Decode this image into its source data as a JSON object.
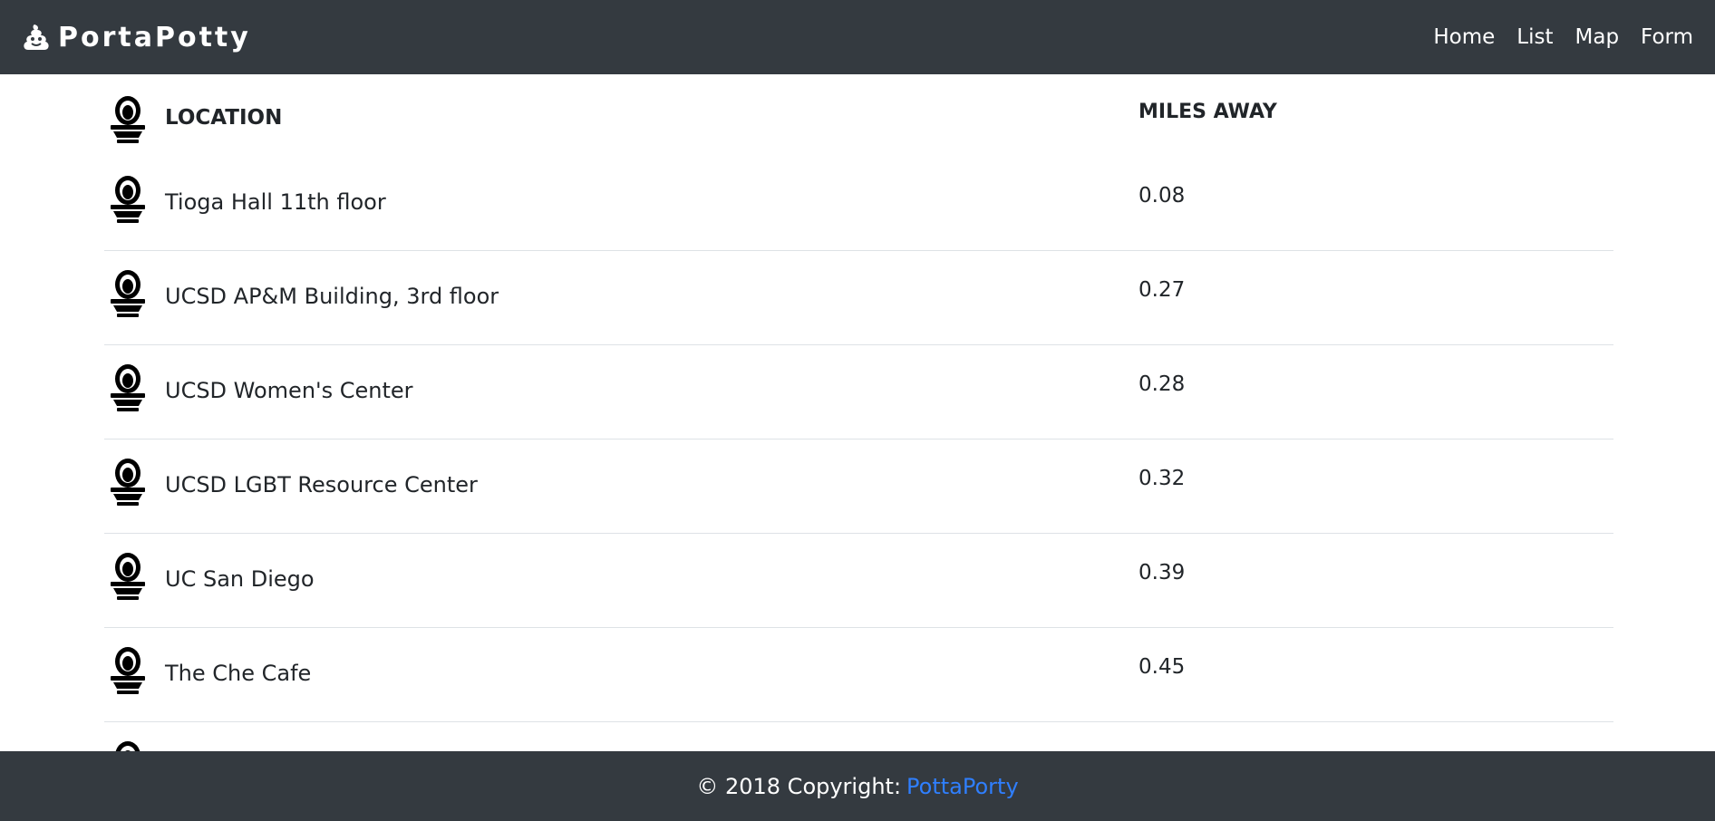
{
  "navbar": {
    "brand": "PortaPotty",
    "brand_icon": "poop-icon",
    "links": [
      "Home",
      "List",
      "Map",
      "Form"
    ]
  },
  "table": {
    "headers": {
      "location": "LOCATION",
      "miles": "MILES AWAY"
    },
    "row_icon": "toilet-icon",
    "rows": [
      {
        "location": "Tioga Hall 11th floor",
        "miles": "0.08"
      },
      {
        "location": "UCSD AP&M Building, 3rd floor",
        "miles": "0.27"
      },
      {
        "location": "UCSD Women's Center",
        "miles": "0.28"
      },
      {
        "location": "UCSD LGBT Resource Center",
        "miles": "0.32"
      },
      {
        "location": "UC San Diego",
        "miles": "0.39"
      },
      {
        "location": "The Che Cafe",
        "miles": "0.45"
      }
    ]
  },
  "footer": {
    "text": "© 2018 Copyright:",
    "link": "PottaPorty",
    "link_color": "#2f7fff"
  },
  "colors": {
    "navbar_bg": "#343a40",
    "footer_bg": "#343a40",
    "row_divider": "#dee2e6"
  }
}
